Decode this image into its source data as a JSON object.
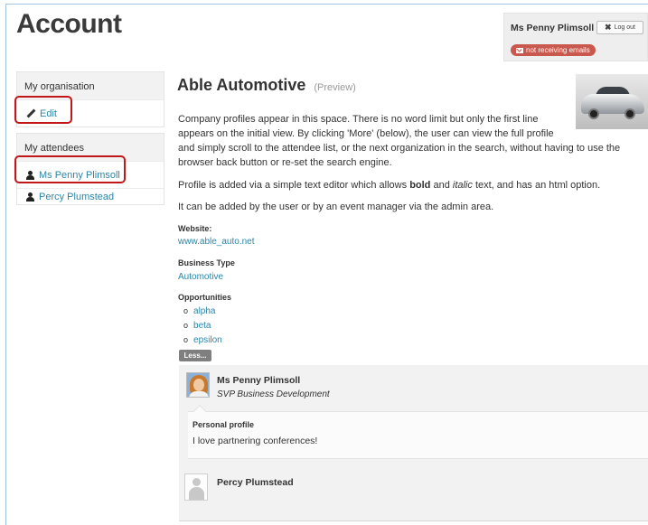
{
  "page": {
    "title": "Account"
  },
  "user": {
    "name": "Ms Penny Plimsoll",
    "logout_label": "Log out",
    "email_status": "not receiving emails"
  },
  "sidebar": {
    "org_header": "My organisation",
    "edit_label": "Edit",
    "attendees_header": "My attendees",
    "attendees": [
      {
        "name": "Ms Penny Plimsoll"
      },
      {
        "name": "Percy Plumstead"
      }
    ]
  },
  "company": {
    "name": "Able Automotive",
    "preview_label": "(Preview)",
    "description_lines": [
      "Company profiles appear in this space. There is no word limit but only the first line",
      "appears on the initial view. By clicking 'More' (below), the user can view the full profile",
      "and simply scroll to the attendee list, or the next organization in the search, without having to use the",
      "browser back button or re-set the search engine."
    ],
    "editor_text_parts": {
      "before": "Profile is added via a simple text editor which allows ",
      "bold": "bold",
      "middle": " and ",
      "italic": "italic",
      "after": " text, and has an html option."
    },
    "admin_text": "It can be added by the user or by an event manager via the admin area.",
    "website_label": "Website:",
    "website": "www.able_auto.net",
    "business_type_label": "Business Type",
    "business_type": "Automotive",
    "opportunities_label": "Opportunities",
    "opportunities": [
      "alpha",
      "beta",
      "epsilon"
    ],
    "less_label": "Less..."
  },
  "attendees": [
    {
      "name": "Ms Penny Plimsoll",
      "role": "SVP Business Development",
      "profile_label": "Personal profile",
      "profile_text": "I love partnering conferences!"
    },
    {
      "name": "Percy Plumstead"
    }
  ],
  "colors": {
    "link": "#2a86a8",
    "highlight": "#c01818",
    "badge": "#c9584f"
  }
}
